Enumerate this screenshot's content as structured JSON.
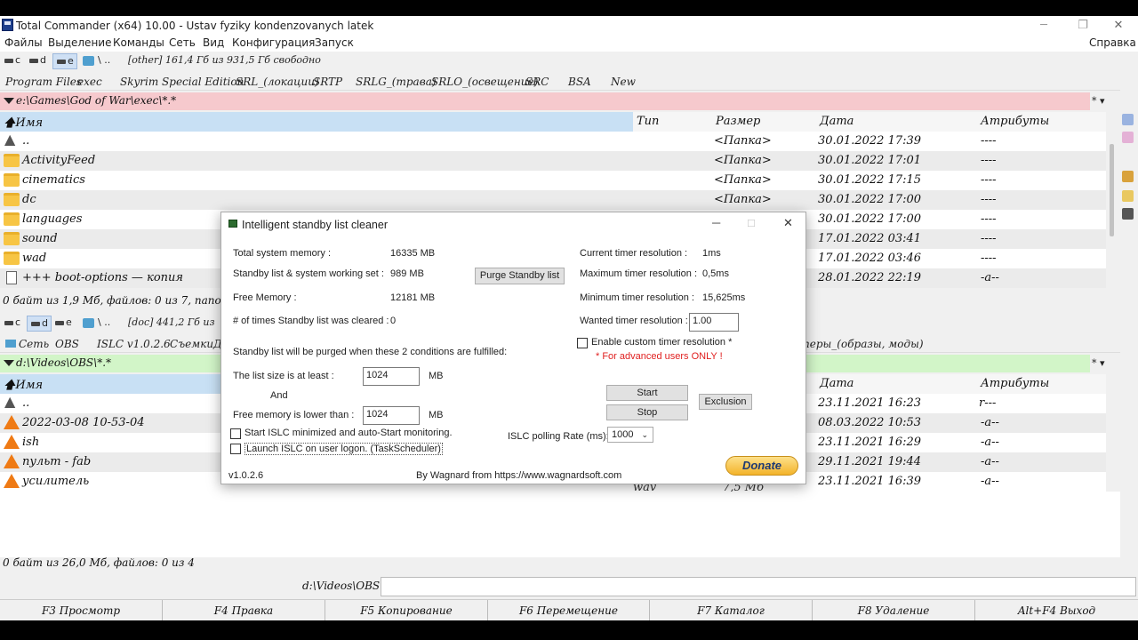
{
  "window": {
    "title": "Total Commander (x64) 10.00 - Ustav fyziky kondenzovanych latek",
    "controls": [
      "─",
      "❐",
      "✕"
    ]
  },
  "menu": {
    "items": [
      "Файлы",
      "Выделение",
      "Команды",
      "Сеть",
      "Вид",
      "Конфигурация",
      "Запуск"
    ],
    "help": "Справка"
  },
  "top_panel": {
    "drives": [
      "c",
      "d",
      "e"
    ],
    "drive_extra": "\\  ..",
    "drive_info": "[other]  161,4 Гб из 931,5 Гб свободно",
    "tabs": [
      "Program Files",
      "exec",
      "Skyrim Special Edition",
      "SRL_(локации)",
      "SRTP",
      "SRLG_(трава)",
      "SRLO_(освещение)",
      "SRC",
      "BSA",
      "New"
    ],
    "path": "e:\\Games\\God of War\\exec\\*.*",
    "path_controls": "*  ▾",
    "headers": {
      "name": "Имя",
      "type": "Тип",
      "size": "Размер",
      "date": "Дата",
      "attr": "Атрибуты"
    },
    "rows": [
      {
        "name": "..",
        "type": "",
        "size": "<Папка>",
        "date": "30.01.2022 17:39",
        "attr": "----",
        "icon": "up-icon"
      },
      {
        "name": "ActivityFeed",
        "type": "",
        "size": "<Папка>",
        "date": "30.01.2022 17:01",
        "attr": "----",
        "icon": "folder-icon"
      },
      {
        "name": "cinematics",
        "type": "",
        "size": "<Папка>",
        "date": "30.01.2022 17:15",
        "attr": "----",
        "icon": "folder-icon"
      },
      {
        "name": "dc",
        "type": "",
        "size": "<Папка>",
        "date": "30.01.2022 17:00",
        "attr": "----",
        "icon": "folder-icon"
      },
      {
        "name": "languages",
        "type": "",
        "size": "",
        "date": "30.01.2022 17:00",
        "attr": "----",
        "icon": "folder-icon"
      },
      {
        "name": "sound",
        "type": "",
        "size": "",
        "date": "17.01.2022 03:41",
        "attr": "----",
        "icon": "folder-icon"
      },
      {
        "name": "wad",
        "type": "",
        "size": "",
        "date": "17.01.2022 03:46",
        "attr": "----",
        "icon": "folder-icon"
      },
      {
        "name": "+++ boot-options — копия",
        "type": "",
        "size": "",
        "date": "28.01.2022 22:19",
        "attr": "-a--",
        "icon": "file-icon"
      }
    ],
    "status": "0 байт из 1,9 Мб, файлов: 0 из 7, папок"
  },
  "bottom_panel": {
    "drives": [
      "c",
      "d",
      "e"
    ],
    "drive_extra": "\\  ..",
    "drive_info": "[doc]  441,2 Гб из",
    "tabs": [
      "Сеть",
      "OBS",
      "ISLC v1.0.2.6",
      "Съемки",
      "Д"
    ],
    "tab_right": "перы_(образы, моды)",
    "path": "d:\\Videos\\OBS\\*.*",
    "path_controls": "*  ▾",
    "headers": {
      "name": "Имя",
      "date": "Дата",
      "attr": "Атрибуты"
    },
    "rows": [
      {
        "name": "..",
        "frag_type": "",
        "frag_size": "",
        "date": "23.11.2021 16:23",
        "attr": "r---",
        "icon": "up-icon"
      },
      {
        "name": "2022-03-08 10-53-04",
        "frag_type": "",
        "frag_size": "",
        "date": "08.03.2022 10:53",
        "attr": "-a--",
        "icon": "vlc-icon"
      },
      {
        "name": "ish",
        "frag_type": "",
        "frag_size": "",
        "date": "23.11.2021 16:29",
        "attr": "-a--",
        "icon": "vlc-icon"
      },
      {
        "name": "пульт - fab",
        "frag_type": "",
        "frag_size": "",
        "date": "29.11.2021 19:44",
        "attr": "-a--",
        "icon": "vlc-icon"
      },
      {
        "name": "усилитель",
        "frag_type": "wav",
        "frag_size": "7,5 Мб",
        "date": "23.11.2021 16:39",
        "attr": "-a--",
        "icon": "vlc-icon"
      }
    ],
    "status": "0 байт из 26,0 Мб, файлов: 0 из 4"
  },
  "command_line": {
    "label": "d:\\Videos\\OBS\\>",
    "value": ""
  },
  "function_keys": [
    "F3 Просмотр",
    "F4 Правка",
    "F5 Копирование",
    "F6 Перемещение",
    "F7 Каталог",
    "F8 Удаление",
    "Alt+F4 Выход"
  ],
  "islc": {
    "title": "Intelligent standby list cleaner",
    "controls": [
      "─",
      "□",
      "✕"
    ],
    "total_memory_label": "Total system memory :",
    "total_memory_value": "16335 MB",
    "standby_label": "Standby list & system working set :",
    "standby_value": "989 MB",
    "purge_button": "Purge Standby list",
    "free_memory_label": "Free Memory :",
    "free_memory_value": "12181 MB",
    "cleared_label": "# of times Standby list was cleared :",
    "cleared_value": "0",
    "current_res_label": "Current timer resolution :",
    "current_res_value": "1ms",
    "max_res_label": "Maximum timer resolution :",
    "max_res_value": "0,5ms",
    "min_res_label": "Minimum timer resolution :",
    "min_res_value": "15,625ms",
    "wanted_res_label": "Wanted timer resolution :",
    "wanted_res_value": "1.00",
    "custom_res_label": "Enable custom timer resolution *",
    "advanced_note": "* For advanced users ONLY !",
    "conditions_text": "Standby list will be purged when these 2 conditions are fulfilled:",
    "list_size_label": "The list size is at least :",
    "list_size_value": "1024",
    "and_text": "And",
    "free_lower_label": "Free memory is lower than :",
    "free_lower_value": "1024",
    "unit": "MB",
    "start_minimized_label": "Start ISLC minimized and auto-Start monitoring.",
    "launch_logon_label": "Launch ISLC on user logon. (TaskScheduler)",
    "polling_label": "ISLC polling Rate (ms):",
    "polling_value": "1000",
    "start_button": "Start",
    "stop_button": "Stop",
    "exclusion_button": "Exclusion",
    "version": "v1.0.2.6",
    "credit": "By Wagnard from https://www.wagnardsoft.com",
    "donate": "Donate",
    "note_color": "#e02020"
  }
}
